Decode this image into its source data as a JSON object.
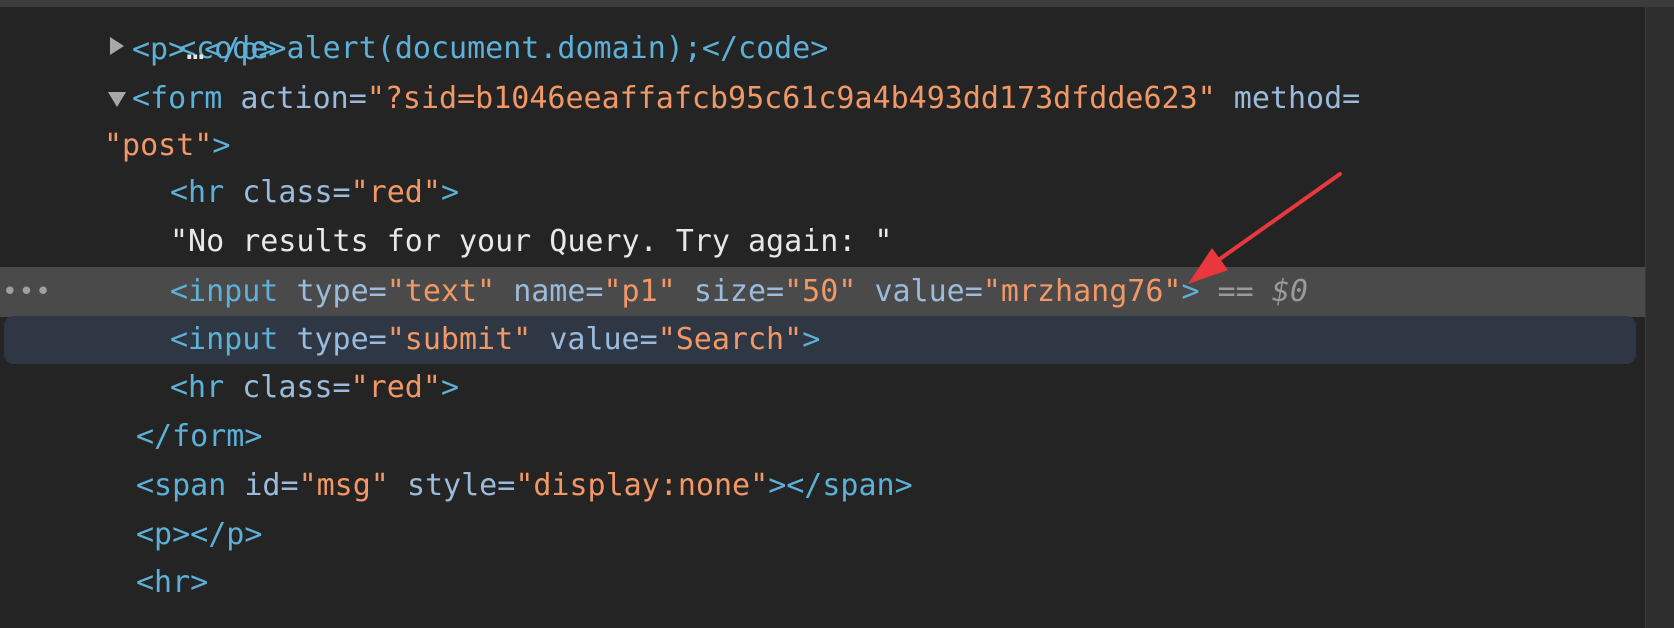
{
  "lines": {
    "l0": "<code>alert(document.domain);</code>",
    "l1": {
      "open": "<p>",
      "ellipsis": "…",
      "close": "</p>"
    },
    "l2": {
      "open": "<form",
      "attr1": "action=",
      "val1": "\"?sid=b1046eeaffafcb95c61c9a4b493dd173dfdde623\"",
      "attr2": "method="
    },
    "l3": {
      "val": "\"post\"",
      "close": ">"
    },
    "l4": {
      "open": "<hr",
      "attr": "class=",
      "val": "\"red\"",
      "close": ">"
    },
    "l5": {
      "text": "\"No results for your Query. Try again: \""
    },
    "l6": {
      "open": "<input",
      "attr1": "type=",
      "val1": "\"text\"",
      "attr2": "name=",
      "val2": "\"p1\"",
      "attr3": "size=",
      "val3": "\"50\"",
      "attr4": "value=",
      "val4": "\"mrzhang76\"",
      "close": ">",
      "eq": "==",
      "dollar": "$0",
      "dots": "•••"
    },
    "l7": {
      "open": "<input",
      "attr1": "type=",
      "val1": "\"submit\"",
      "attr2": "value=",
      "val2": "\"Search\"",
      "close": ">"
    },
    "l8": {
      "open": "<hr",
      "attr": "class=",
      "val": "\"red\"",
      "close": ">"
    },
    "l9": {
      "close": "</form>"
    },
    "l10": {
      "open": "<span",
      "attr1": "id=",
      "val1": "\"msg\"",
      "attr2": "style=",
      "val2": "\"display:none\"",
      "close": "></span>"
    },
    "l11": {
      "text": "<p></p>"
    },
    "l12": {
      "text": "<hr>"
    }
  },
  "colors": {
    "tag": "#5db0d7",
    "attribute": "#9bbbdc",
    "value": "#f29766",
    "text": "#e8e8e8",
    "arrow": "#e8383d"
  }
}
